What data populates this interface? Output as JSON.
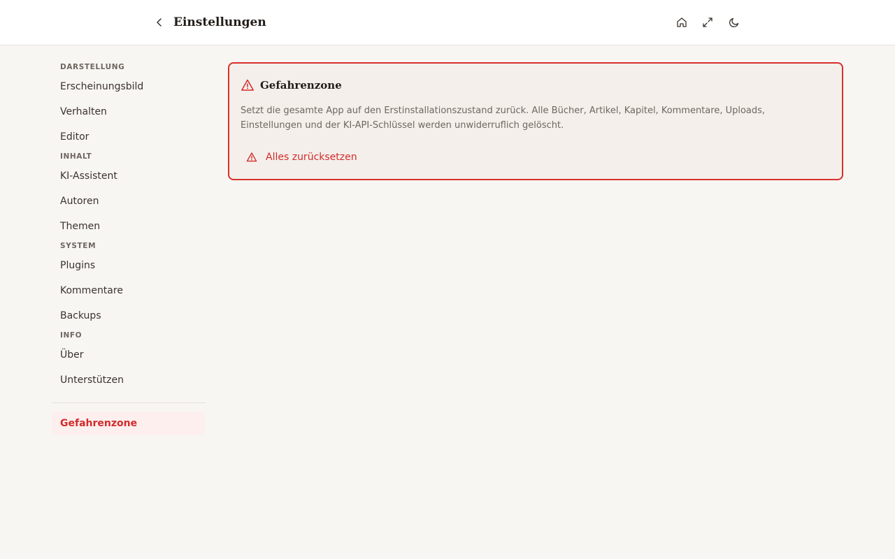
{
  "header": {
    "title": "Einstellungen",
    "icons": [
      "back-icon",
      "home-icon",
      "expand-icon",
      "moon-icon"
    ]
  },
  "sidebar": {
    "sections": [
      {
        "title": "DARSTELLUNG",
        "items": [
          "Erscheinungsbild",
          "Verhalten",
          "Editor"
        ]
      },
      {
        "title": "INHALT",
        "items": [
          "KI-Assistent",
          "Autoren",
          "Themen"
        ]
      },
      {
        "title": "SYSTEM",
        "items": [
          "Plugins",
          "Kommentare",
          "Backups"
        ]
      },
      {
        "title": "INFO",
        "items": [
          "Über",
          "Unterstützen"
        ]
      }
    ],
    "danger_item": "Gefahrenzone"
  },
  "danger_zone": {
    "title": "Gefahrenzone",
    "description": "Setzt die gesamte App auf den Erstinstallationszustand zurück. Alle Bücher, Artikel, Kapitel, Kommentare, Uploads, Einstellungen und der KI-API-Schlüssel werden unwiderruflich gelöscht.",
    "reset_label": "Alles zurücksetzen"
  },
  "colors": {
    "danger": "#d22b2b",
    "background": "#f8f6f3",
    "card_background": "#f4efea"
  }
}
